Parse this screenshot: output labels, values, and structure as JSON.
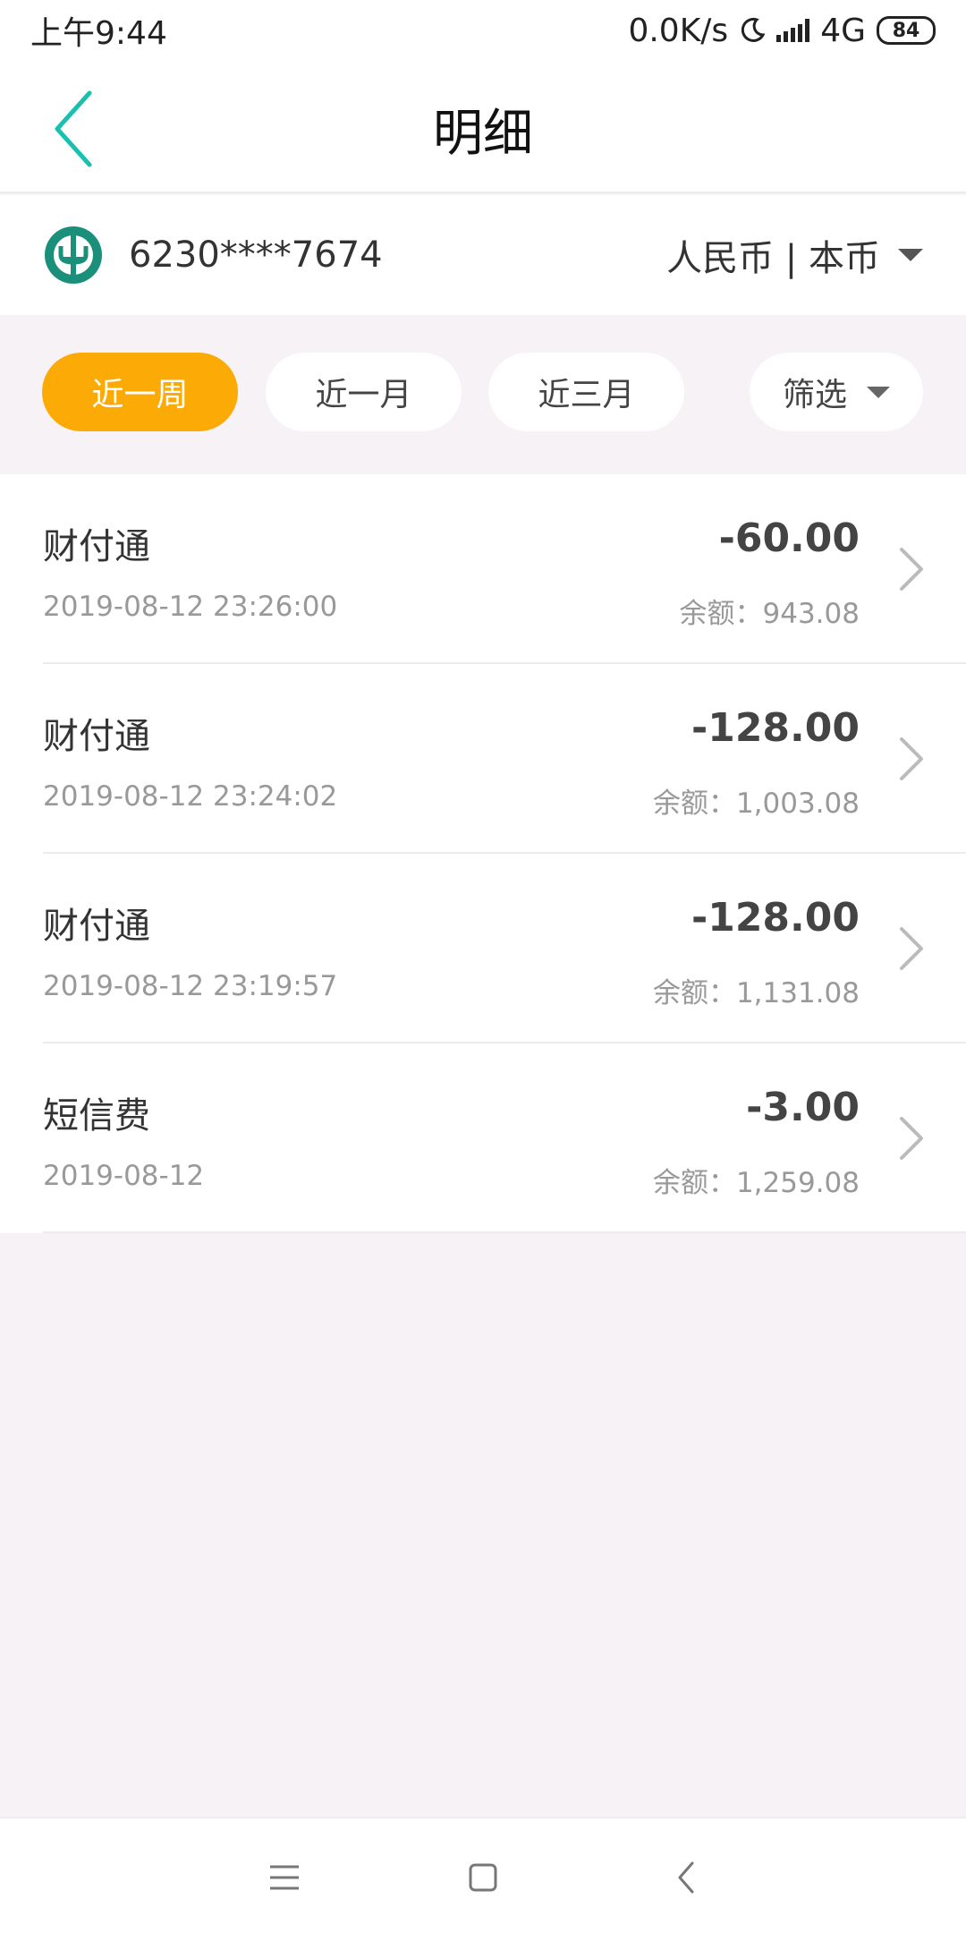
{
  "status_bar": {
    "time": "上午9:44",
    "speed": "0.0K/s",
    "network": "4G",
    "battery": "84"
  },
  "nav": {
    "title": "明细"
  },
  "account": {
    "number": "6230****7674",
    "currency": "人民币 | 本币"
  },
  "filters": {
    "week": "近一周",
    "month": "近一月",
    "three_months": "近三月",
    "filter": "筛选",
    "active": "近一周"
  },
  "transactions": [
    {
      "name": "财付通",
      "time": "2019-08-12 23:26:00",
      "amount": "-60.00",
      "balance": "余额：943.08"
    },
    {
      "name": "财付通",
      "time": "2019-08-12 23:24:02",
      "amount": "-128.00",
      "balance": "余额：1,003.08"
    },
    {
      "name": "财付通",
      "time": "2019-08-12 23:19:57",
      "amount": "-128.00",
      "balance": "余额：1,131.08"
    },
    {
      "name": "短信费",
      "time": "2019-08-12",
      "amount": "-3.00",
      "balance": "余额：1,259.08"
    }
  ],
  "colors": {
    "accent": "#fcaa06",
    "bank_green": "#1a8f7a",
    "back_teal": "#18c0b0"
  }
}
